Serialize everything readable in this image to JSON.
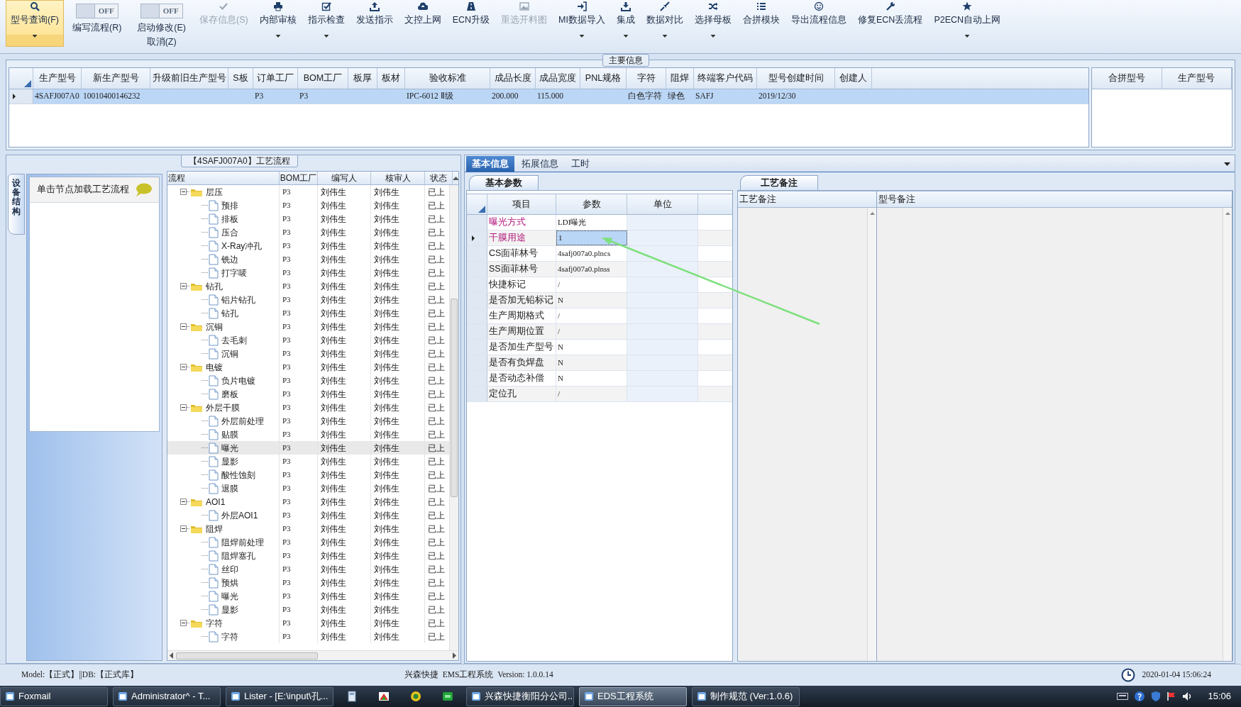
{
  "toolbar": {
    "items": [
      {
        "kind": "button",
        "label": "型号查询(F)",
        "selected": true,
        "disabled": false,
        "dropdown": true
      },
      {
        "kind": "toggle",
        "label": "编写流程(R)",
        "switch_text": "OFF",
        "on": false
      },
      {
        "kind": "toggle",
        "label": "启动修改(E)",
        "sublabel": "取消(Z)",
        "switch_text": "OFF",
        "on": false
      },
      {
        "kind": "button",
        "label": "保存信息(S)",
        "selected": false,
        "disabled": true,
        "dropdown": false
      },
      {
        "kind": "button",
        "label": "内部审核",
        "selected": false,
        "disabled": false,
        "dropdown": true
      },
      {
        "kind": "button",
        "label": "指示检查",
        "selected": false,
        "disabled": false,
        "dropdown": true
      },
      {
        "kind": "button",
        "label": "发送指示",
        "selected": false,
        "disabled": false,
        "dropdown": false
      },
      {
        "kind": "button",
        "label": "文控上网",
        "selected": false,
        "disabled": false,
        "dropdown": false
      },
      {
        "kind": "button",
        "label": "ECN升级",
        "selected": false,
        "disabled": false,
        "dropdown": false
      },
      {
        "kind": "button",
        "label": "重选开料图",
        "selected": false,
        "disabled": true,
        "dropdown": false
      },
      {
        "kind": "button",
        "label": "MI数据导入",
        "selected": false,
        "disabled": false,
        "dropdown": true
      },
      {
        "kind": "button",
        "label": "集成",
        "selected": false,
        "disabled": false,
        "dropdown": true
      },
      {
        "kind": "button",
        "label": "数据对比",
        "selected": false,
        "disabled": false,
        "dropdown": true
      },
      {
        "kind": "button",
        "label": "选择母板",
        "selected": false,
        "disabled": false,
        "dropdown": true
      },
      {
        "kind": "button",
        "label": "合拼模块",
        "selected": false,
        "disabled": false,
        "dropdown": false
      },
      {
        "kind": "button",
        "label": "导出流程信息",
        "selected": false,
        "disabled": false,
        "dropdown": false
      },
      {
        "kind": "button",
        "label": "修复ECN丢流程",
        "selected": false,
        "disabled": false,
        "dropdown": false
      },
      {
        "kind": "button",
        "label": "P2ECN自动上网",
        "selected": false,
        "disabled": false,
        "dropdown": true
      }
    ]
  },
  "main_info": {
    "title": "主要信息",
    "table": {
      "columns": [
        "生产型号",
        "新生产型号",
        "升级前旧生产型号",
        "S板",
        "订单工厂",
        "BOM工厂",
        "板厚",
        "板材",
        "验收标准",
        "成品长度",
        "成品宽度",
        "PNL规格",
        "字符",
        "阻焊",
        "终端客户代码",
        "型号创建时间",
        "创建人"
      ],
      "rows": [
        {
          "selected": true,
          "cells": [
            "4SAFJ007A0",
            "10010400146232",
            null,
            null,
            "P3",
            "P3",
            null,
            null,
            "IPC-6012 Ⅱ级",
            "200.000",
            "115.000",
            null,
            "白色字符",
            "绿色",
            "SAFJ",
            "2019/12/30",
            null
          ]
        }
      ]
    },
    "merge_table": {
      "columns": [
        "合拼型号",
        "生产型号"
      ]
    }
  },
  "process": {
    "title": "【4SAFJ007A0】工艺流程",
    "side_tab": {
      "label": "设备结构",
      "selected": true
    },
    "hint": "单击节点加载工艺流程",
    "tree": {
      "columns": [
        "流程",
        "BOM工厂",
        "编写人",
        "核审人",
        "状态"
      ],
      "nodes": [
        {
          "name": "层压",
          "bom": "P3",
          "writer": "刘伟生",
          "reviewer": "刘伟生",
          "status": "已上",
          "expanded": true,
          "selected": false,
          "children": [
            {
              "name": "预排",
              "bom": "P3",
              "writer": "刘伟生",
              "reviewer": "刘伟生",
              "status": "已上",
              "selected": false
            },
            {
              "name": "排板",
              "bom": "P3",
              "writer": "刘伟生",
              "reviewer": "刘伟生",
              "status": "已上",
              "selected": false
            },
            {
              "name": "压合",
              "bom": "P3",
              "writer": "刘伟生",
              "reviewer": "刘伟生",
              "status": "已上",
              "selected": false
            },
            {
              "name": "X-Ray冲孔",
              "bom": "P3",
              "writer": "刘伟生",
              "reviewer": "刘伟生",
              "status": "已上",
              "selected": false
            },
            {
              "name": "铣边",
              "bom": "P3",
              "writer": "刘伟生",
              "reviewer": "刘伟生",
              "status": "已上",
              "selected": false
            },
            {
              "name": "打字唛",
              "bom": "P3",
              "writer": "刘伟生",
              "reviewer": "刘伟生",
              "status": "已上",
              "selected": false
            }
          ]
        },
        {
          "name": "钻孔",
          "bom": "P3",
          "writer": "刘伟生",
          "reviewer": "刘伟生",
          "status": "已上",
          "expanded": true,
          "selected": false,
          "children": [
            {
              "name": "铝片钻孔",
              "bom": "P3",
              "writer": "刘伟生",
              "reviewer": "刘伟生",
              "status": "已上",
              "selected": false
            },
            {
              "name": "钻孔",
              "bom": "P3",
              "writer": "刘伟生",
              "reviewer": "刘伟生",
              "status": "已上",
              "selected": false
            }
          ]
        },
        {
          "name": "沉铜",
          "bom": "P3",
          "writer": "刘伟生",
          "reviewer": "刘伟生",
          "status": "已上",
          "expanded": true,
          "selected": false,
          "children": [
            {
              "name": "去毛刺",
              "bom": "P3",
              "writer": "刘伟生",
              "reviewer": "刘伟生",
              "status": "已上",
              "selected": false
            },
            {
              "name": "沉铜",
              "bom": "P3",
              "writer": "刘伟生",
              "reviewer": "刘伟生",
              "status": "已上",
              "selected": false
            }
          ]
        },
        {
          "name": "电镀",
          "bom": "P3",
          "writer": "刘伟生",
          "reviewer": "刘伟生",
          "status": "已上",
          "expanded": true,
          "selected": false,
          "children": [
            {
              "name": "负片电镀",
              "bom": "P3",
              "writer": "刘伟生",
              "reviewer": "刘伟生",
              "status": "已上",
              "selected": false
            },
            {
              "name": "磨板",
              "bom": "P3",
              "writer": "刘伟生",
              "reviewer": "刘伟生",
              "status": "已上",
              "selected": false
            }
          ]
        },
        {
          "name": "外层干膜",
          "bom": "P3",
          "writer": "刘伟生",
          "reviewer": "刘伟生",
          "status": "已上",
          "expanded": true,
          "selected": false,
          "children": [
            {
              "name": "外层前处理",
              "bom": "P3",
              "writer": "刘伟生",
              "reviewer": "刘伟生",
              "status": "已上",
              "selected": false
            },
            {
              "name": "贴膜",
              "bom": "P3",
              "writer": "刘伟生",
              "reviewer": "刘伟生",
              "status": "已上",
              "selected": false
            },
            {
              "name": "曝光",
              "bom": "P3",
              "writer": "刘伟生",
              "reviewer": "刘伟生",
              "status": "已上",
              "selected": true
            },
            {
              "name": "显影",
              "bom": "P3",
              "writer": "刘伟生",
              "reviewer": "刘伟生",
              "status": "已上",
              "selected": false
            },
            {
              "name": "酸性蚀刻",
              "bom": "P3",
              "writer": "刘伟生",
              "reviewer": "刘伟生",
              "status": "已上",
              "selected": false
            },
            {
              "name": "退膜",
              "bom": "P3",
              "writer": "刘伟生",
              "reviewer": "刘伟生",
              "status": "已上",
              "selected": false
            }
          ]
        },
        {
          "name": "AOI1",
          "bom": "P3",
          "writer": "刘伟生",
          "reviewer": "刘伟生",
          "status": "已上",
          "expanded": true,
          "selected": false,
          "children": [
            {
              "name": "外层AOI1",
              "bom": "P3",
              "writer": "刘伟生",
              "reviewer": "刘伟生",
              "status": "已上",
              "selected": false
            }
          ]
        },
        {
          "name": "阻焊",
          "bom": "P3",
          "writer": "刘伟生",
          "reviewer": "刘伟生",
          "status": "已上",
          "expanded": true,
          "selected": false,
          "children": [
            {
              "name": "阻焊前处理",
              "bom": "P3",
              "writer": "刘伟生",
              "reviewer": "刘伟生",
              "status": "已上",
              "selected": false
            },
            {
              "name": "阻焊塞孔",
              "bom": "P3",
              "writer": "刘伟生",
              "reviewer": "刘伟生",
              "status": "已上",
              "selected": false
            },
            {
              "name": "丝印",
              "bom": "P3",
              "writer": "刘伟生",
              "reviewer": "刘伟生",
              "status": "已上",
              "selected": false
            },
            {
              "name": "预烘",
              "bom": "P3",
              "writer": "刘伟生",
              "reviewer": "刘伟生",
              "status": "已上",
              "selected": false
            },
            {
              "name": "曝光",
              "bom": "P3",
              "writer": "刘伟生",
              "reviewer": "刘伟生",
              "status": "已上",
              "selected": false
            },
            {
              "name": "显影",
              "bom": "P3",
              "writer": "刘伟生",
              "reviewer": "刘伟生",
              "status": "已上",
              "selected": false
            }
          ]
        },
        {
          "name": "字符",
          "bom": "P3",
          "writer": "刘伟生",
          "reviewer": "刘伟生",
          "status": "已上",
          "expanded": true,
          "selected": false,
          "children": [
            {
              "name": "字符",
              "bom": "P3",
              "writer": "刘伟生",
              "reviewer": "刘伟生",
              "status": "已上",
              "selected": false
            }
          ]
        }
      ]
    }
  },
  "detail": {
    "tabs": [
      {
        "label": "基本信息",
        "selected": true
      },
      {
        "label": "拓展信息",
        "selected": false
      },
      {
        "label": "工时",
        "selected": false
      }
    ],
    "params": {
      "title": "基本参数",
      "columns": [
        "项目",
        "参数",
        "单位"
      ],
      "rows": [
        {
          "item": "曝光方式",
          "value": "LDI曝光",
          "highlighted": true,
          "selected": false
        },
        {
          "item": "干膜用途",
          "value": "1",
          "highlighted": true,
          "selected": true
        },
        {
          "item": "CS面菲林号",
          "value": "4safj007a0.plncs",
          "highlighted": false,
          "selected": false
        },
        {
          "item": "SS面菲林号",
          "value": "4safj007a0.plnss",
          "highlighted": false,
          "selected": false
        },
        {
          "item": "快捷标记",
          "value": "/",
          "highlighted": false,
          "selected": false
        },
        {
          "item": "是否加无铅标记",
          "value": "N",
          "highlighted": false,
          "selected": false
        },
        {
          "item": "生产周期格式",
          "value": "/",
          "highlighted": false,
          "selected": false
        },
        {
          "item": "生产周期位置",
          "value": "/",
          "highlighted": false,
          "selected": false
        },
        {
          "item": "是否加生产型号",
          "value": "N",
          "highlighted": false,
          "selected": false
        },
        {
          "item": "是否有负焊盘",
          "value": "N",
          "highlighted": false,
          "selected": false
        },
        {
          "item": "是否动态补偿",
          "value": "N",
          "highlighted": false,
          "selected": false
        },
        {
          "item": "定位孔",
          "value": "/",
          "highlighted": false,
          "selected": false
        }
      ]
    },
    "notes": {
      "title": "工艺备注",
      "columns": [
        "工艺备注",
        "型号备注"
      ]
    }
  },
  "status_bar": {
    "left": "Model:【正式】||DB:【正式库】",
    "center": "兴森快捷  EMS工程系统  Version: 1.0.0.14",
    "datetime": "2020-01-04 15:06:24"
  },
  "taskbar": {
    "items": [
      {
        "kind": "app",
        "label": "Foxmail",
        "selected": false
      },
      {
        "kind": "app",
        "label": "Administrator^ - T...",
        "selected": false
      },
      {
        "kind": "app",
        "label": "Lister - [E:\\input\\孔...",
        "selected": false
      },
      {
        "kind": "icon"
      },
      {
        "kind": "icon"
      },
      {
        "kind": "icon"
      },
      {
        "kind": "icon"
      },
      {
        "kind": "app",
        "label": "兴森快捷衡阳分公司...",
        "selected": false
      },
      {
        "kind": "app",
        "label": "EDS工程系统",
        "selected": true
      },
      {
        "kind": "app",
        "label": "制作规范 (Ver:1.0.6)",
        "selected": false
      }
    ],
    "clock": "15:06"
  }
}
